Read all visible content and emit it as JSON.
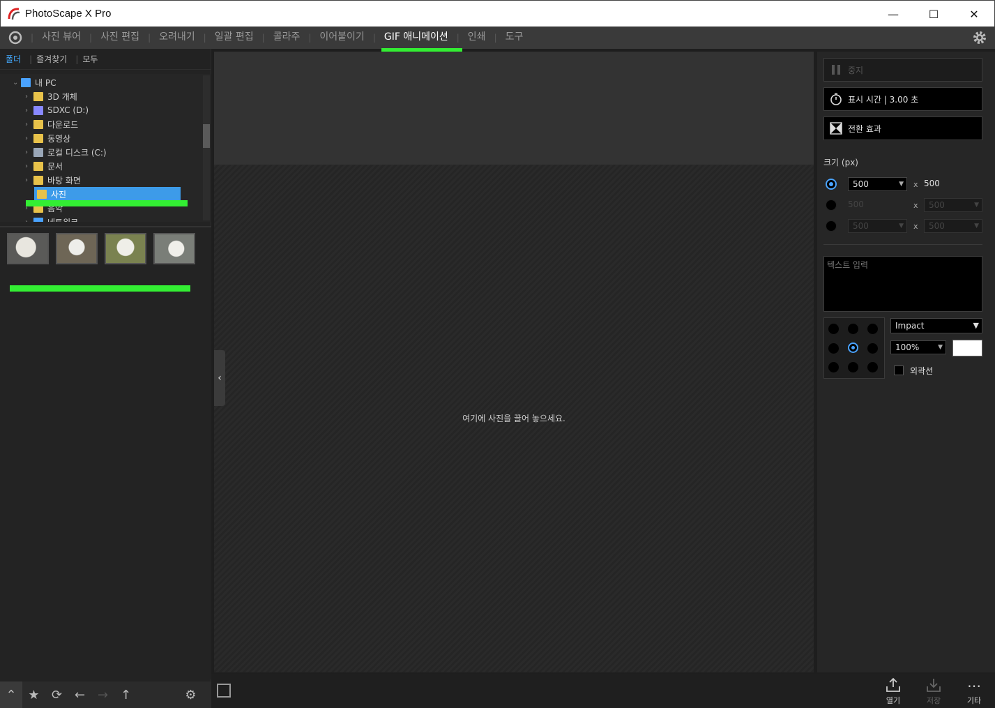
{
  "window": {
    "title": "PhotoScape X Pro",
    "minimize": "—",
    "maximize": "☐",
    "close": "✕"
  },
  "menu": {
    "items": [
      {
        "label": "사진 뷰어"
      },
      {
        "label": "사진 편집"
      },
      {
        "label": "오려내기"
      },
      {
        "label": "일괄 편집"
      },
      {
        "label": "콜라주"
      },
      {
        "label": "이어붙이기"
      },
      {
        "label": "GIF 애니메이션",
        "active": true
      },
      {
        "label": "인쇄"
      },
      {
        "label": "도구"
      }
    ]
  },
  "left": {
    "tabs": [
      "폴더",
      "즐겨찾기",
      "모두"
    ],
    "tree": [
      {
        "label": "내 PC",
        "chev": "⌄",
        "color": "#4aa3ff"
      },
      {
        "label": "3D 개체",
        "chev": "›",
        "color": "#e8c24a"
      },
      {
        "label": "SDXC (D:)",
        "chev": "›",
        "color": "#8888ff"
      },
      {
        "label": "다운로드",
        "chev": "›",
        "color": "#e8c24a"
      },
      {
        "label": "동영상",
        "chev": "›",
        "color": "#e8c24a"
      },
      {
        "label": "로컬 디스크 (C:)",
        "chev": "›",
        "color": "#9aa7b8"
      },
      {
        "label": "문서",
        "chev": "›",
        "color": "#e8c24a"
      },
      {
        "label": "바탕 화면",
        "chev": "›",
        "color": "#e8c24a"
      },
      {
        "label": "사진",
        "chev": "",
        "color": "#e8c24a",
        "selected": true
      },
      {
        "label": "음악",
        "chev": "›",
        "color": "#e8c24a"
      },
      {
        "label": "네트워크",
        "chev": "›",
        "color": "#4aa3ff"
      }
    ],
    "thumbnail_colors": [
      "#8a8a86",
      "#6f6a5a",
      "#7f8654",
      "#7b7f78"
    ],
    "bottom_icons": [
      "chevron-up-icon",
      "star-icon",
      "sync-icon",
      "back-arrow-icon",
      "forward-arrow-icon",
      "up-arrow-icon",
      "gear-icon"
    ]
  },
  "center": {
    "drop_hint": "여기에 사진을 끌어 놓으세요."
  },
  "right": {
    "stop_label": "중지",
    "duration_label": "표시 시간 | 3.00 초",
    "transition_label": "전환 효과",
    "size_label": "크기 (px)",
    "size_rows": [
      {
        "w": "500",
        "x": "x",
        "h": "500"
      },
      {
        "w": "500",
        "x": "x",
        "h": "500"
      },
      {
        "w": "500",
        "x": "x",
        "h": "500"
      }
    ],
    "text_placeholder": "텍스트 입력",
    "font": "Impact",
    "opacity": "100%",
    "outline_label": "외곽선"
  },
  "bottom": {
    "open_label": "열기",
    "save_label": "저장",
    "more_label": "기타"
  },
  "colors": {
    "accent": "#4aa3ff",
    "highlight": "#33ee33",
    "selected_row": "#3d9be9"
  }
}
